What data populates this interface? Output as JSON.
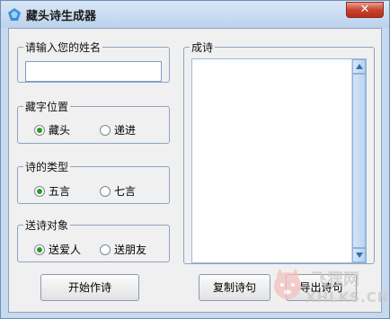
{
  "window": {
    "title": "藏头诗生成器",
    "close_label": "✕"
  },
  "name_group": {
    "legend": "请输入您的姓名",
    "input_value": ""
  },
  "position_group": {
    "legend": "藏字位置",
    "options": [
      "藏头",
      "递进"
    ],
    "selected": "藏头"
  },
  "type_group": {
    "legend": "诗的类型",
    "options": [
      "五言",
      "七言"
    ],
    "selected": "五言"
  },
  "recipient_group": {
    "legend": "送诗对象",
    "options": [
      "送爱人",
      "送朋友"
    ],
    "selected": "送爱人"
  },
  "poem_group": {
    "legend": "成诗",
    "text": ""
  },
  "buttons": {
    "start": "开始作诗",
    "copy": "复制诗句",
    "export": "导出诗句"
  },
  "watermark": {
    "name": "飞狸网",
    "url": "XHLKS.CN"
  },
  "colors": {
    "titlebar": "#c6d9ee",
    "close": "#c8442e",
    "selected_radio": "#2a9a2a"
  }
}
